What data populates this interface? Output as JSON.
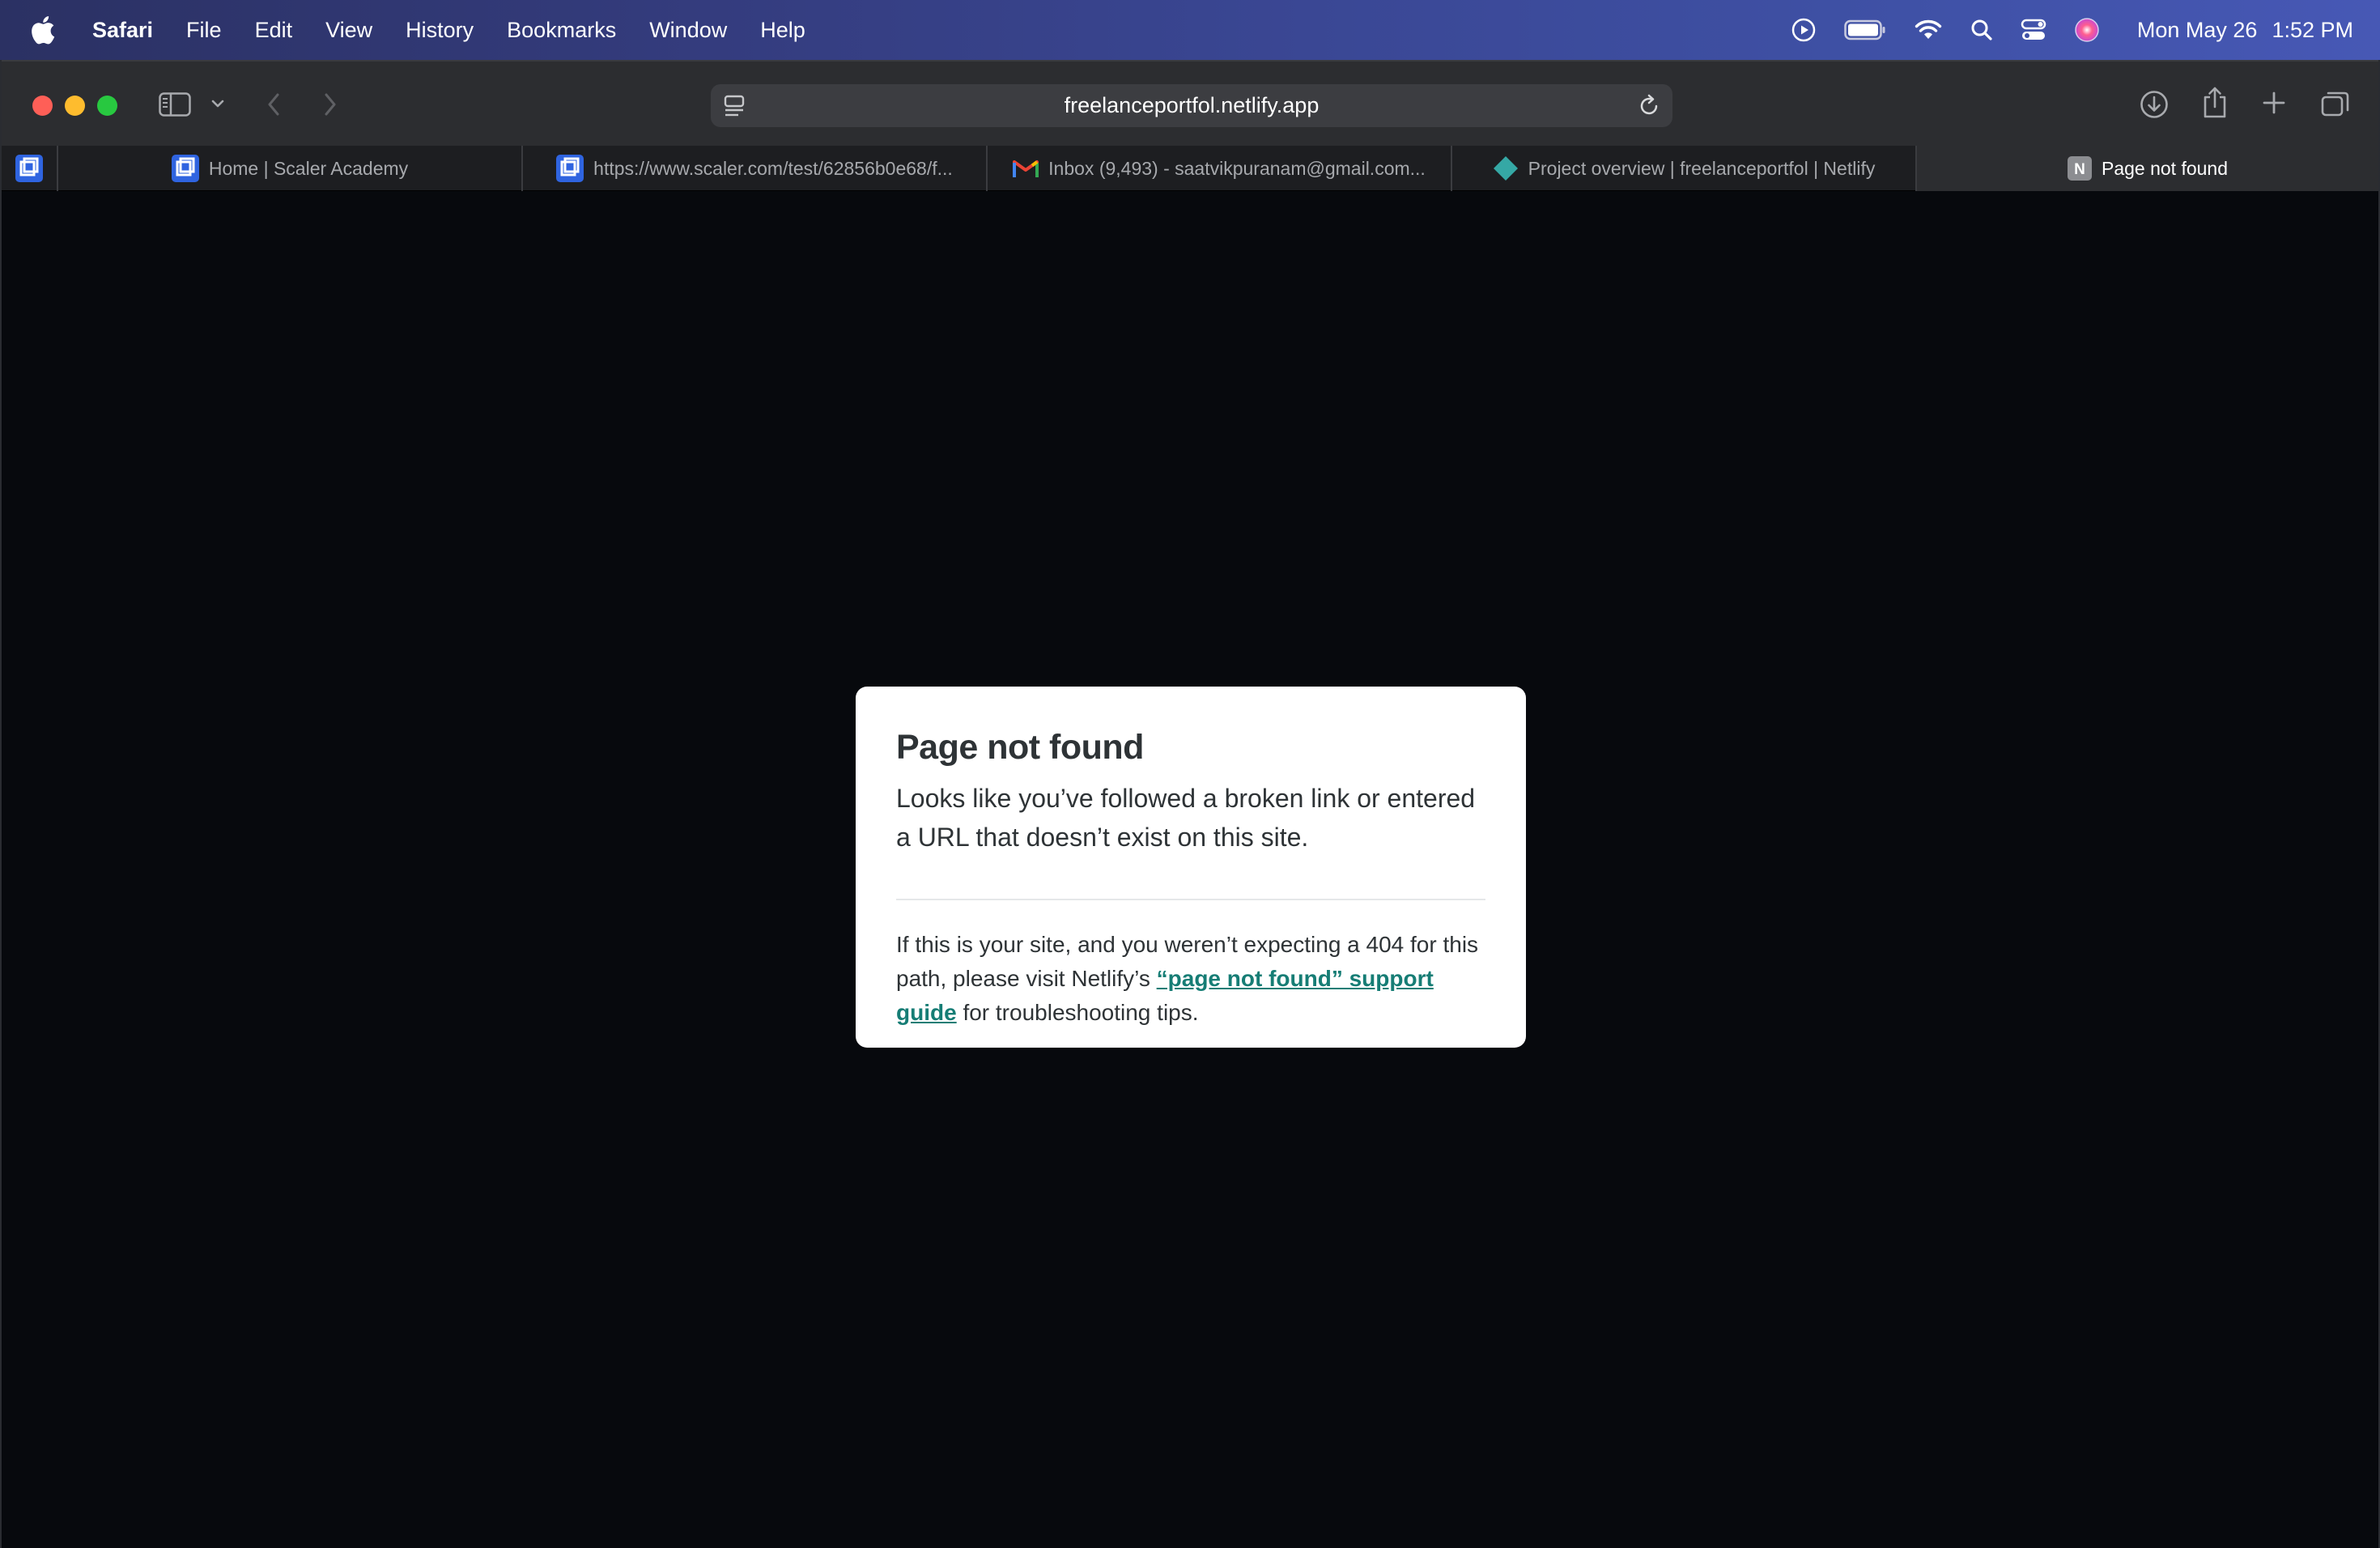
{
  "menubar": {
    "items": [
      "Safari",
      "File",
      "Edit",
      "View",
      "History",
      "Bookmarks",
      "Window",
      "Help"
    ],
    "date": "Mon May 26",
    "time": "1:52 PM",
    "status_icons": [
      "now-playing-icon",
      "battery-icon",
      "wifi-icon",
      "spotlight-search-icon",
      "control-center-icon",
      "siri-icon"
    ]
  },
  "toolbar": {
    "url": "freelanceportfol.netlify.app"
  },
  "tabs": [
    {
      "title": "",
      "icon": "scaler-favicon",
      "pinned": true
    },
    {
      "title": "Home | Scaler Academy",
      "icon": "scaler-favicon"
    },
    {
      "title": "https://www.scaler.com/test/62856b0e68/f...",
      "icon": "scaler-favicon"
    },
    {
      "title": "Inbox (9,493) - saatvikpuranam@gmail.com...",
      "icon": "gmail-favicon"
    },
    {
      "title": "Project overview | freelanceportfol | Netlify",
      "icon": "netlify-favicon"
    },
    {
      "title": "Page not found",
      "icon": "n-favicon",
      "active": true
    }
  ],
  "page": {
    "heading": "Page not found",
    "lead": "Looks like you’ve followed a broken link or entered a URL that doesn’t exist on this site.",
    "tips_before": "If this is your site, and you weren’t expecting a 404 for this path, please visit Netlify’s ",
    "link_text": "“page not found” support guide",
    "tips_after": " for troubleshooting tips."
  },
  "colors": {
    "page_background": "#07090d",
    "card_background": "#ffffff",
    "link": "#167d75",
    "close": "#fe5f57",
    "minimize": "#febc2e",
    "zoom": "#28c840"
  }
}
